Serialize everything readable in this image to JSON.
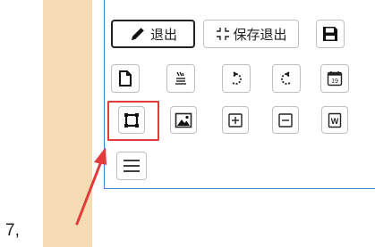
{
  "margin_number": "7,",
  "toolbar": {
    "exit_label": "退出",
    "save_exit_label": "保存退出",
    "calendar_day": "19",
    "word_letter": "W"
  },
  "annotation": {
    "highlight_color": "#e23b3b",
    "accent_border_color": "#3d86d6",
    "strip_color": "#f5dcb5"
  }
}
